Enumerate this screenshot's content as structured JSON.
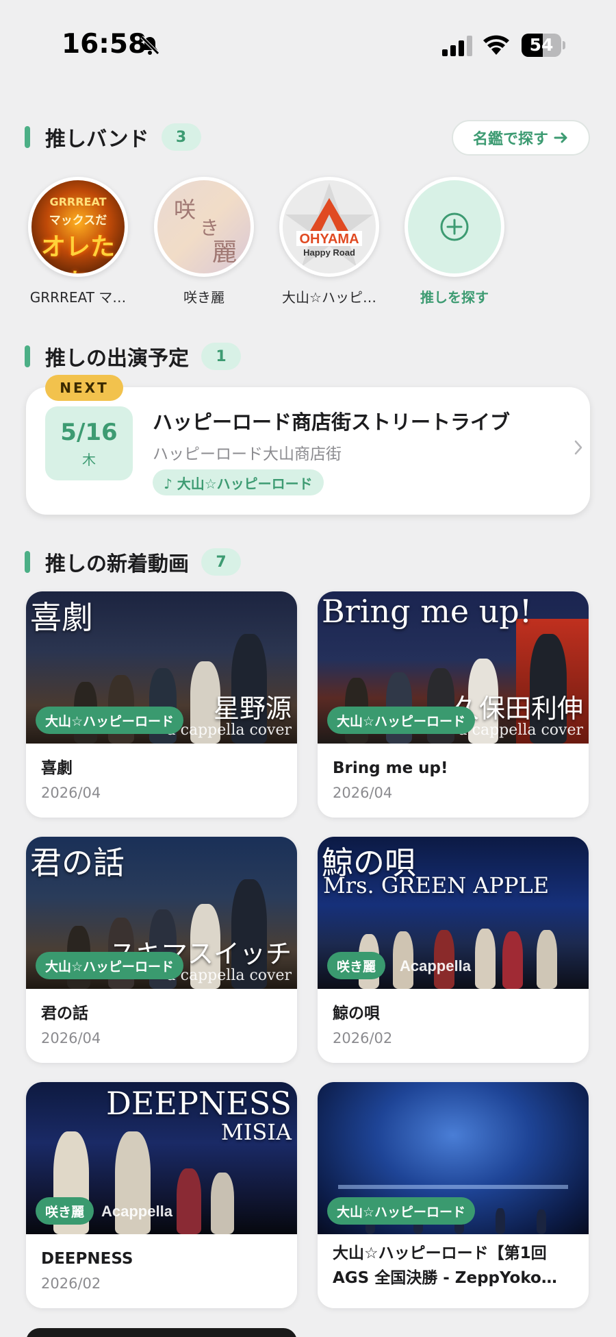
{
  "status_bar": {
    "time": "16:58",
    "battery": "54",
    "battery_level_percent": 54,
    "icons": [
      "bell-slash-icon",
      "cellular-signal-icon",
      "wifi-icon",
      "battery-icon"
    ]
  },
  "bands_section": {
    "title": "推しバンド",
    "count": "3",
    "directory_button_label": "名鑑で探す",
    "directory_button_icon": "arrow-right-icon",
    "bands": [
      {
        "name": "GRRREAT マ…",
        "avatar_text": [
          "GRRREAT",
          "マックスだ",
          "オレたち"
        ]
      },
      {
        "name": "咲き麗",
        "avatar_text": [
          "咲",
          "き",
          "麗"
        ]
      },
      {
        "name": "大山☆ハッピ…",
        "avatar_text": [
          "OHYAMA",
          "Happy Road"
        ]
      }
    ],
    "add_label": "推しを探す",
    "add_icon": "plus-circle-icon"
  },
  "schedule_section": {
    "title": "推しの出演予定",
    "count": "1",
    "next_badge": "NEXT",
    "event": {
      "date": "5/16",
      "weekday": "木",
      "title": "ハッピーロード商店街ストリートライブ",
      "venue": "ハッピーロード大山商店街",
      "band_tag": "♪ 大山☆ハッピーロード"
    }
  },
  "videos_section": {
    "title": "推しの新着動画",
    "count": "7",
    "videos": [
      {
        "title": "喜劇",
        "date": "2026/04",
        "band_tag": "大山☆ハッピーロード",
        "thumb_title": "喜劇",
        "thumb_artist": "星野源",
        "thumb_sub": "a cappella cover"
      },
      {
        "title": "Bring me up!",
        "date": "2026/04",
        "band_tag": "大山☆ハッピーロード",
        "thumb_title": "Bring me up!",
        "thumb_artist": "久保田利伸",
        "thumb_sub": "a cappella cover"
      },
      {
        "title": "君の話",
        "date": "2026/04",
        "band_tag": "大山☆ハッピーロード",
        "thumb_title": "君の話",
        "thumb_artist": "スキマスイッチ",
        "thumb_sub": "a cappella cover"
      },
      {
        "title": "鯨の唄",
        "date": "2026/02",
        "band_tag": "咲き麗",
        "thumb_title": "鯨の唄",
        "thumb_artist": "Mrs. GREEN APPLE",
        "thumb_sub": "Acappella"
      },
      {
        "title": "DEEPNESS",
        "date": "2026/02",
        "band_tag": "咲き麗",
        "thumb_title": "DEEPNESS",
        "thumb_artist": "MISIA",
        "thumb_sub": "Acappella"
      },
      {
        "title": "大山☆ハッピーロード【第1回 AGS 全国決勝 - ZeppYoko…",
        "date": "",
        "band_tag": "大山☆ハッピーロード",
        "thumb_title": "",
        "thumb_artist": "",
        "thumb_sub": ""
      }
    ]
  },
  "colors": {
    "accent": "#3d9b72",
    "accent_light": "#d8f1e6",
    "next_badge": "#f2c24d",
    "background": "#efeff0"
  }
}
